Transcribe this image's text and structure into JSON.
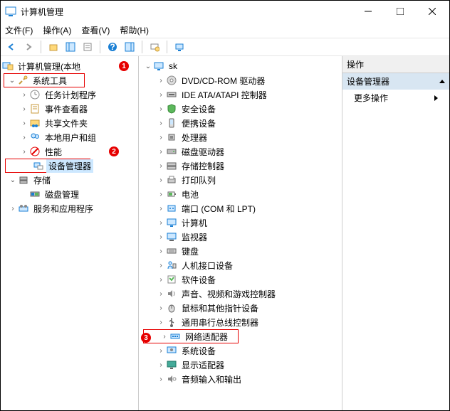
{
  "window": {
    "title": "计算机管理"
  },
  "menu": {
    "file": "文件(F)",
    "action": "操作(A)",
    "view": "查看(V)",
    "help": "帮助(H)"
  },
  "left_tree": {
    "root": "计算机管理(本地",
    "sys_tools": "系统工具",
    "task_sched": "任务计划程序",
    "event_viewer": "事件查看器",
    "shared_folders": "共享文件夹",
    "local_users": "本地用户和组",
    "performance": "性能",
    "device_mgr": "设备管理器",
    "storage": "存储",
    "disk_mgmt": "磁盘管理",
    "services": "服务和应用程序"
  },
  "mid_tree": {
    "root": "sk",
    "dvd": "DVD/CD-ROM 驱动器",
    "ide": "IDE ATA/ATAPI 控制器",
    "security": "安全设备",
    "portable": "便携设备",
    "cpu": "处理器",
    "disk_drives": "磁盘驱动器",
    "storage_ctrl": "存储控制器",
    "print_queue": "打印队列",
    "battery": "电池",
    "ports": "端口 (COM 和 LPT)",
    "computer": "计算机",
    "monitor": "监视器",
    "keyboard": "键盘",
    "hid": "人机接口设备",
    "software_dev": "软件设备",
    "sound": "声音、视频和游戏控制器",
    "mouse": "鼠标和其他指针设备",
    "usb_serial": "通用串行总线控制器",
    "network": "网络适配器",
    "system_dev": "系统设备",
    "display": "显示适配器",
    "audio_io": "音频输入和输出"
  },
  "actions": {
    "header": "操作",
    "selected": "设备管理器",
    "more": "更多操作"
  },
  "badges": {
    "b1": "1",
    "b2": "2",
    "b3": "3"
  }
}
